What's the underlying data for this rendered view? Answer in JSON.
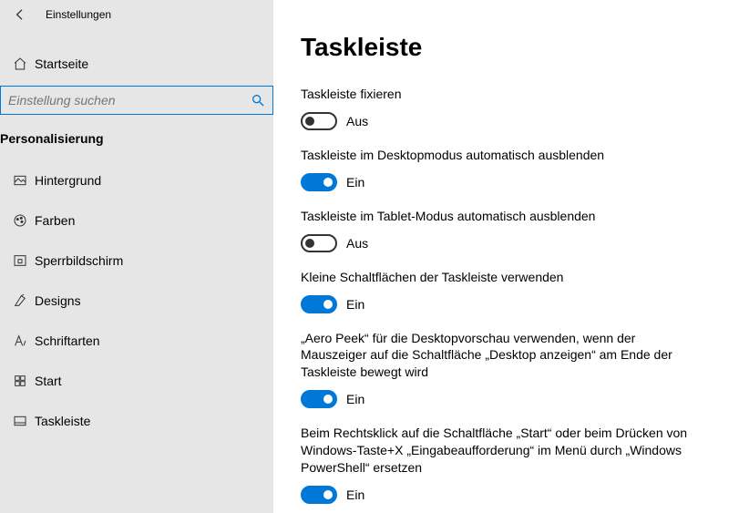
{
  "header": {
    "window_title": "Einstellungen"
  },
  "sidebar": {
    "home_label": "Startseite",
    "search_placeholder": "Einstellung suchen",
    "section_title": "Personalisierung",
    "items": [
      {
        "label": "Hintergrund"
      },
      {
        "label": "Farben"
      },
      {
        "label": "Sperrbildschirm"
      },
      {
        "label": "Designs"
      },
      {
        "label": "Schriftarten"
      },
      {
        "label": "Start"
      },
      {
        "label": "Taskleiste"
      }
    ]
  },
  "main": {
    "title": "Taskleiste",
    "toggle_on_text": "Ein",
    "toggle_off_text": "Aus",
    "settings": [
      {
        "desc": "Taskleiste fixieren",
        "state": "off"
      },
      {
        "desc": "Taskleiste im Desktopmodus automatisch ausblenden",
        "state": "on"
      },
      {
        "desc": "Taskleiste im Tablet-Modus automatisch ausblenden",
        "state": "off"
      },
      {
        "desc": "Kleine Schaltflächen der Taskleiste verwenden",
        "state": "on"
      },
      {
        "desc": "„Aero Peek“ für die Desktopvorschau verwenden, wenn der Mauszeiger auf die Schaltfläche „Desktop anzeigen“ am Ende der Taskleiste bewegt wird",
        "state": "on"
      },
      {
        "desc": "Beim Rechtsklick auf die Schaltfläche „Start“ oder beim Drücken von Windows-Taste+X „Eingabeaufforderung“ im Menü durch „Windows PowerShell“ ersetzen",
        "state": "on"
      }
    ]
  }
}
